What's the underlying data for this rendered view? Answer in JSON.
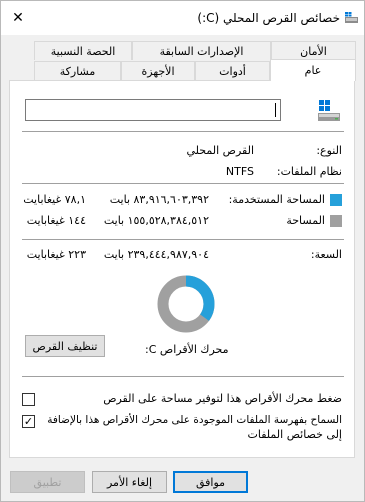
{
  "window": {
    "title": "خصائص القرص المحلي (C:)",
    "close_glyph": "✕"
  },
  "tabs_row1": [
    {
      "label": "الأمان"
    },
    {
      "label": "الإصدارات السابقة"
    },
    {
      "label": "الحصة النسبية"
    }
  ],
  "tabs_row2": [
    {
      "label": "عام",
      "active": true
    },
    {
      "label": "أدوات"
    },
    {
      "label": "الأجهزة"
    },
    {
      "label": "مشاركة"
    }
  ],
  "general": {
    "name_value": "",
    "type_label": "النوع:",
    "type_value": "القرص المحلي",
    "fs_label": "نظام الملفات:",
    "fs_value": "NTFS",
    "used_label": "المساحة المستخدمة:",
    "used_bytes": "٨٣,٩١٦,٦٠٣,٣٩٢ بايت",
    "used_gb": "٧٨,١ غيغابايت",
    "free_label": "المساحة",
    "free_bytes": "١٥٥,٥٢٨,٣٨٤,٥١٢ بايت",
    "free_gb": "١٤٤ غيغابايت",
    "capacity_label": "السعة:",
    "capacity_bytes": "٢٣٩,٤٤٤,٩٨٧,٩٠٤ بايت",
    "capacity_gb": "٢٢٣ غيغابايت",
    "drive_label": "محرك الأقراص C:",
    "cleanup_label": "تنظيف القرص",
    "used_fraction": 0.35,
    "colors": {
      "used": "#26a0da",
      "free": "#a0a0a0"
    },
    "compress_label": "ضغط محرك الأقراص هذا لتوفير مساحة على القرص",
    "compress_checked": false,
    "index_label_line1": "السماح بفهرسة الملفات الموجودة على محرك الأقراص هذا بالإضافة",
    "index_label_line2": "إلى خصائص الملفات",
    "index_checked": true
  },
  "buttons": {
    "ok": "موافق",
    "cancel": "إلغاء الأمر",
    "apply": "تطبيق"
  }
}
